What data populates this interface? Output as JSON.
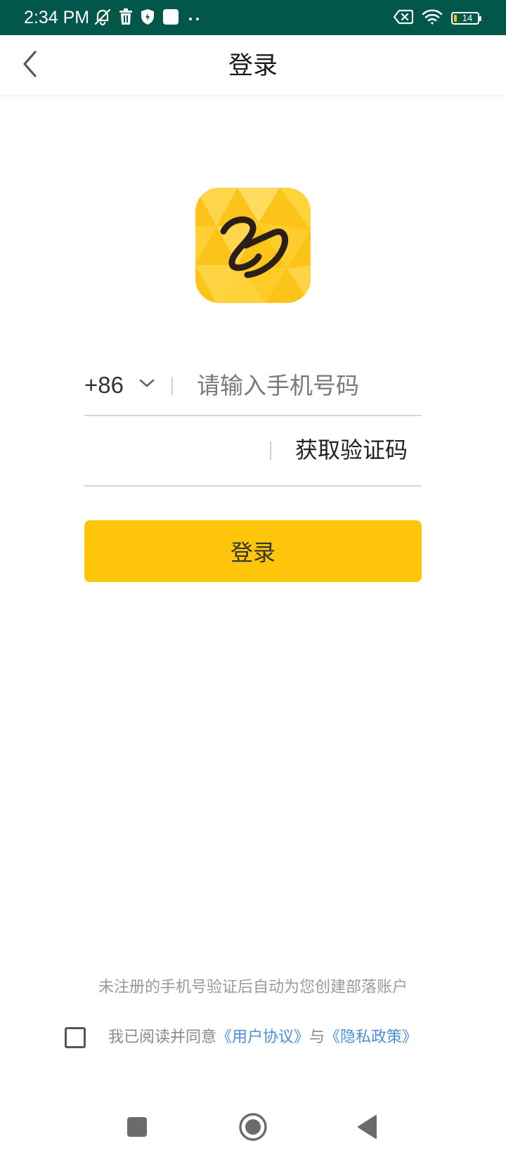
{
  "status_bar": {
    "time": "2:34 PM",
    "battery_level": "14",
    "battery_fraction": 0.14,
    "background_color": "#01574a",
    "left_icons": [
      "muted-bell-icon",
      "trash-icon",
      "shield-icon",
      "square-icon",
      "more-dots-icon"
    ],
    "right_icons": [
      "no-sim-icon",
      "wifi-icon",
      "battery-icon"
    ]
  },
  "header": {
    "title": "登录",
    "back_icon": "chevron-left-icon"
  },
  "logo": {
    "icon": "app-logo-icon",
    "colors": [
      "#ffd43b",
      "#fcb900",
      "#2b1f1a"
    ]
  },
  "phone": {
    "country_code": "+86",
    "placeholder": "请输入手机号码",
    "value": ""
  },
  "verification": {
    "placeholder": "",
    "value": "",
    "get_code_label": "获取验证码"
  },
  "login_button": {
    "label": "登录",
    "color": "#fec50a"
  },
  "footer": {
    "notice": "未注册的手机号验证后自动为您创建部落账户",
    "agree_prefix": "我已阅读并同意",
    "user_agreement": "《用户协议》",
    "conjunction": "与",
    "privacy_policy": "《隐私政策》",
    "link_color": "#4a90d9"
  },
  "nav_bar": {
    "icons": [
      "recents-square-icon",
      "home-circle-icon",
      "back-triangle-icon"
    ]
  }
}
